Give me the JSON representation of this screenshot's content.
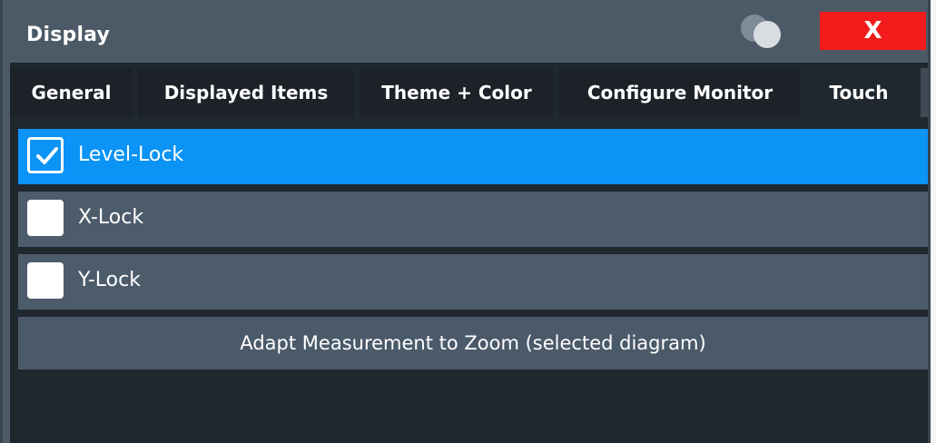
{
  "window": {
    "title": "Display",
    "close_label": "X"
  },
  "tabs": [
    {
      "label": "General",
      "active": false
    },
    {
      "label": "Displayed Items",
      "active": false
    },
    {
      "label": "Theme + Color",
      "active": false
    },
    {
      "label": "Configure Monitor",
      "active": false
    },
    {
      "label": "Touch",
      "active": true
    }
  ],
  "touch": {
    "options": [
      {
        "label": "Level-Lock",
        "checked": true
      },
      {
        "label": "X-Lock",
        "checked": false
      },
      {
        "label": "Y-Lock",
        "checked": false
      }
    ],
    "adapt_button_label": "Adapt Measurement to Zoom (selected diagram)"
  },
  "colors": {
    "accent": "#0b93f6",
    "close": "#f21c1c",
    "panel": "#4d5a67",
    "dark_panel": "#1f272f"
  },
  "icons": {
    "help": "help-icon",
    "close": "close-icon",
    "checkmark": "checkmark-icon"
  }
}
